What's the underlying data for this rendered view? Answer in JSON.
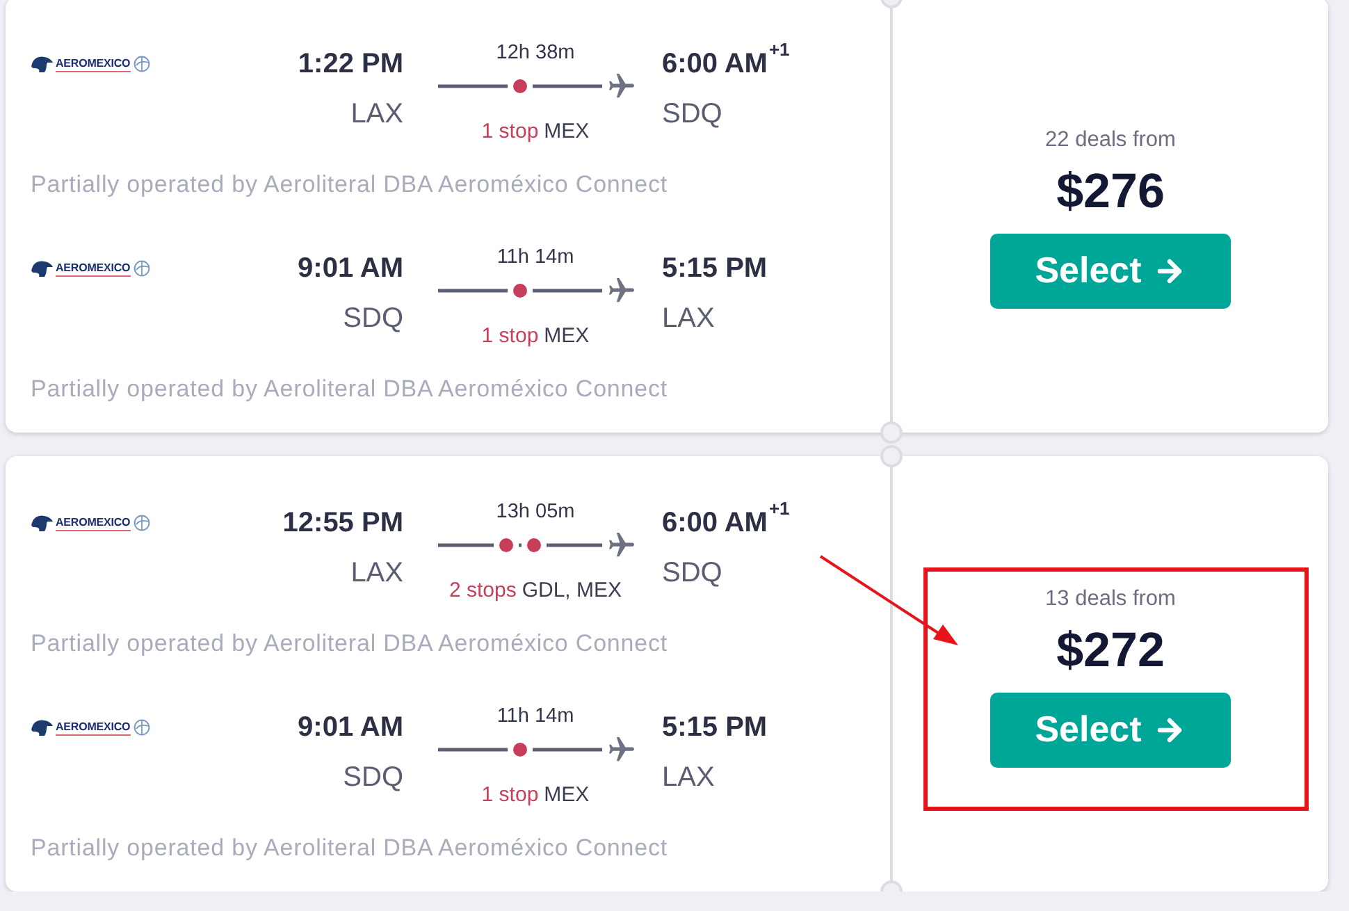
{
  "offers": [
    {
      "legs": [
        {
          "kind": "one_stop",
          "airline_logo": "AEROMEXICO",
          "depart_time": "1:22 PM",
          "depart_airport": "LAX",
          "duration": "12h 38m",
          "stops_label": "1 stop",
          "stop_airports": "MEX",
          "arrive_time": "6:00 AM",
          "day_offset": "+1",
          "arrive_airport": "SDQ",
          "operated_by": "Partially operated by Aeroliteral DBA Aeroméxico Connect"
        },
        {
          "kind": "one_stop",
          "airline_logo": "AEROMEXICO",
          "depart_time": "9:01 AM",
          "depart_airport": "SDQ",
          "duration": "11h 14m",
          "stops_label": "1 stop",
          "stop_airports": "MEX",
          "arrive_time": "5:15 PM",
          "arrive_airport": "LAX",
          "operated_by": "Partially operated by Aeroliteral DBA Aeroméxico Connect"
        }
      ],
      "deals": "22 deals from",
      "price": "$276",
      "button": "Select",
      "highlighted": false
    },
    {
      "legs": [
        {
          "kind": "two_stops",
          "airline_logo": "AEROMEXICO",
          "depart_time": "12:55 PM",
          "depart_airport": "LAX",
          "duration": "13h 05m",
          "stops_label": "2 stops",
          "stop_airports": "GDL, MEX",
          "arrive_time": "6:00 AM",
          "day_offset": "+1",
          "arrive_airport": "SDQ",
          "operated_by": "Partially operated by Aeroliteral DBA Aeroméxico Connect"
        },
        {
          "kind": "one_stop",
          "airline_logo": "AEROMEXICO",
          "depart_time": "9:01 AM",
          "depart_airport": "SDQ",
          "duration": "11h 14m",
          "stops_label": "1 stop",
          "stop_airports": "MEX",
          "arrive_time": "5:15 PM",
          "arrive_airport": "LAX",
          "operated_by": "Partially operated by Aeroliteral DBA Aeroméxico Connect"
        }
      ],
      "deals": "13 deals from",
      "price": "$272",
      "button": "Select",
      "highlighted": true
    }
  ]
}
